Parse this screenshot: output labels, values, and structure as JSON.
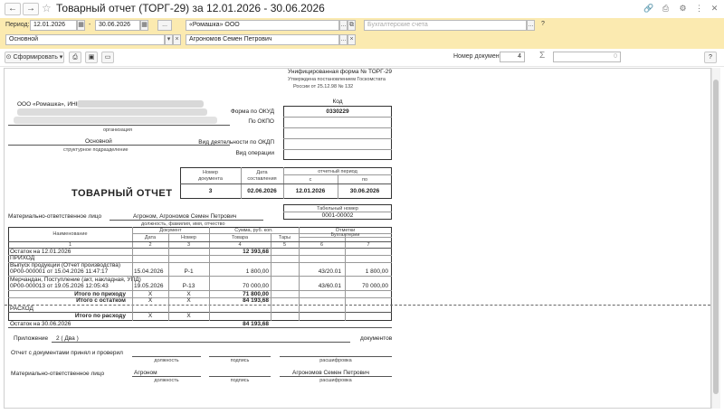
{
  "window": {
    "title": "Товарный отчет (ТОРГ-29) за 12.01.2026 - 30.06.2026",
    "back_glyph": "←",
    "fwd_glyph": "→",
    "star_glyph": "☆",
    "icon_glyphs": [
      "🔗",
      "⎙",
      "⚙",
      "⋮",
      "✕"
    ]
  },
  "params": {
    "period_label": "Период:",
    "date_from": "12.01.2026",
    "dash": "-",
    "date_to": "30.06.2026",
    "dots": "...",
    "org": "«Ромашка» ООО",
    "accounts_placeholder": "Бухгалтерские счета",
    "question": "?",
    "warehouse": "Основной",
    "person": "Агрономов Семен Петрович",
    "ellipsis_btn": "...",
    "copy_btn": "⧉",
    "x_btn": "×",
    "drop_btn": "▾"
  },
  "toolbar": {
    "generate_label": "Сформировать",
    "generate_arrow": "▾",
    "docnum_label": "Номер документа:",
    "docnum_value": "4",
    "sigma": "Σ",
    "sum_value": "0",
    "help": "?"
  },
  "doc": {
    "form_header_1": "Унифицированная форма № ТОРГ-29",
    "form_header_2": "Утверждена постановлением Госкомстата",
    "form_header_3": "России от  25.12.98  № 132",
    "org_name": "ООО «Ромашка», ИНН",
    "org_caption": "организация",
    "dept_name": "Основной",
    "dept_caption": "структурное подразделение",
    "code_header": "Код",
    "okud_label": "Форма по ОКУД",
    "okud_value": "0330229",
    "okpo_label": "По ОКПО",
    "okdp_label": "Вид деятельности по ОКДП",
    "operation_label": "Вид операции",
    "doc_title": "ТОВАРНЫЙ ОТЧЕТ",
    "h_num_1": "Номер",
    "h_num_2": "документа",
    "h_date_1": "Дата",
    "h_date_2": "составления",
    "h_period": "отчетный период",
    "h_from": "с",
    "h_to": "по",
    "v_num": "3",
    "v_date": "02.06.2026",
    "v_from": "12.01.2026",
    "v_to": "30.06.2026",
    "tab_header": "Табельный номер",
    "tab_value": "0001-00002",
    "mol_label": "Материально-ответственное лицо",
    "mol_value": "Агроном, Агрономов Семен Петрович",
    "mol_caption": "должность, фамилия, имя, отчество",
    "col_name": "Наименование",
    "col_document": "Документ",
    "col_date": "Дата",
    "col_number": "Номер",
    "col_sum": "Сумма, руб. коп.",
    "col_goods": "Товара",
    "col_tare": "Тары",
    "col_marks": "Отметки",
    "col_buh": "Бухгалтерии",
    "col_nums": [
      "1",
      "2",
      "3",
      "4",
      "5",
      "6",
      "7"
    ],
    "rows": {
      "start_label": "Остаток на 12.01.2026",
      "start_sum": "12 393,68",
      "income_label": "ПРИХОД",
      "r1_name_1": "Выпуск продукции (Отчет производства)",
      "r1_name_2": "0Р00-000001 от 15.04.2026 11:47:17",
      "r1_date": "15.04.2026",
      "r1_num": "Р-1",
      "r1_sum": "1 800,00",
      "r1_acc": "43/20.01",
      "r1_acc_sum": "1 800,00",
      "r2_name_1": "Мерчандан, Поступление (акт, накладная, УПД)",
      "r2_name_2": "0Р00-000013 от 19.05.2026 12:05:43",
      "r2_date": "19.05.2026",
      "r2_num": "Р-13",
      "r2_sum": "70 000,00",
      "r2_acc": "43/60.01",
      "r2_acc_sum": "70 000,00",
      "total_income_label": "Итого по приходу",
      "total_income_sum": "71 800,00",
      "total_with_rest_label": "Итого с остатком",
      "total_with_rest_sum": "84 193,68",
      "expense_label": "РАСХОД",
      "total_expense_label": "Итого по расходу",
      "end_label": "Остаток на 30.06.2026",
      "end_sum": "84 193,68",
      "x": "X"
    },
    "appendix_label": "Приложение",
    "appendix_value": "2 ( Два )",
    "appendix_docs": "документов",
    "accepted_label": "Отчет с документами принял и проверил",
    "cap_position": "должность",
    "cap_signature": "подпись",
    "cap_decode": "расшифровка",
    "mol2_label": "Материально-ответственное лицо",
    "mol2_position": "Агроном",
    "mol2_decode": "Агрономов Семен Петрович"
  },
  "colors": {
    "params_bg": "#fbeab0",
    "field_border": "#b9b9b9"
  }
}
